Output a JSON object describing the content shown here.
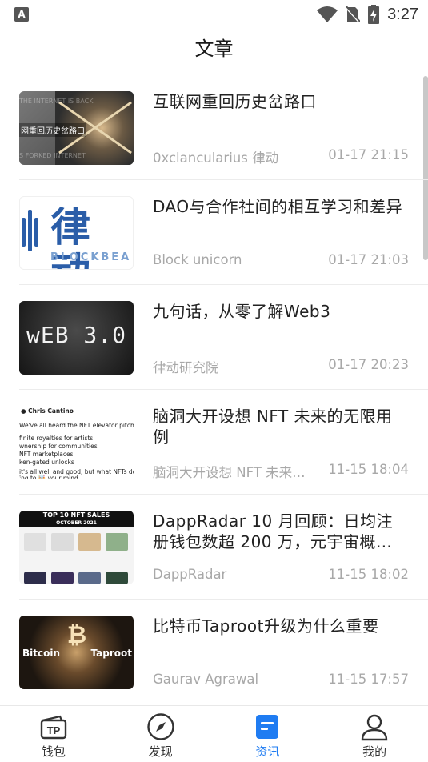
{
  "status_bar": {
    "app_icon_letter": "A",
    "time": "3:27"
  },
  "header": {
    "title": "文章"
  },
  "articles": [
    {
      "title": "互联网重回历史岔路口",
      "author": "0xclancularius  律动",
      "time": "01-17 21:15",
      "thumb_text": "网重回历史岔路口"
    },
    {
      "title": "DAO与合作社间的相互学习和差异",
      "author": "Block unicorn",
      "time": "01-17 21:03",
      "thumb_text": "律动",
      "thumb_subtext": "BLOCKBEA"
    },
    {
      "title": "九句话，从零了解Web3",
      "author": "律动研究院",
      "time": "01-17 20:23",
      "thumb_text": "wEB 3.0"
    },
    {
      "title": "脑洞大开设想 NFT 未来的无限用例",
      "author": "脑洞大开设想 NFT 未来…",
      "time": "11-15 18:04"
    },
    {
      "title": "DappRadar 10 月回顾：日均注册钱包数超 200 万，元宇宙概…",
      "author": "DappRadar",
      "time": "11-15 18:02",
      "thumb_text": "TOP 10 NFT SALES",
      "thumb_subtext": "OCTOBER 2021"
    },
    {
      "title": "比特币Taproot升级为什么重要",
      "author": "Gaurav Agrawal",
      "time": "11-15 17:57",
      "thumb_text": "Bitcoin",
      "thumb_subtext": "Taproot"
    }
  ],
  "bottom_nav": [
    {
      "label": "钱包",
      "icon": "wallet-tp-icon",
      "icon_text": "TP"
    },
    {
      "label": "发现",
      "icon": "compass-icon"
    },
    {
      "label": "资讯",
      "icon": "news-icon",
      "active": true
    },
    {
      "label": "我的",
      "icon": "profile-icon"
    }
  ],
  "colors": {
    "accent": "#1f7cf2",
    "muted_text": "#a8a8a8"
  }
}
